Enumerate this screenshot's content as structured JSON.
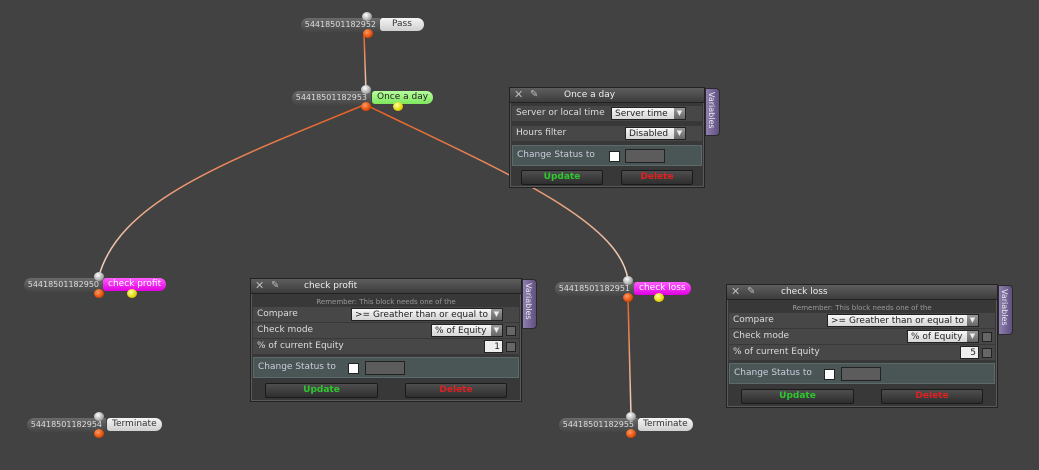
{
  "colors": {
    "wire_orange": "#e85e20",
    "wire_white": "#f0d8c8",
    "background": "#424242"
  },
  "nodes": {
    "pass": {
      "id": "54418501182952",
      "label": "Pass"
    },
    "once": {
      "id": "54418501182953",
      "label": "Once a day"
    },
    "profit": {
      "id": "54418501182950",
      "label": "check profit"
    },
    "loss": {
      "id": "54418501182951",
      "label": "check loss"
    },
    "term_profit": {
      "id": "54418501182954",
      "label": "Terminate"
    },
    "term_loss": {
      "id": "54418501182955",
      "label": "Terminate"
    }
  },
  "panel_once": {
    "title": "Once a day",
    "tab": "Variables",
    "server_label": "Server or local time",
    "server_value": "Server time",
    "hours_label": "Hours filter",
    "hours_value": "Disabled",
    "status_label": "Change Status to",
    "update": "Update",
    "delete": "Delete"
  },
  "panel_profit": {
    "title": "check profit",
    "tab": "Variables",
    "note": "Remember: This block needs one of the",
    "compare_label": "Compare",
    "compare_value": ">= Greather than or equal to",
    "mode_label": "Check mode",
    "mode_value": "% of Equity",
    "equity_label": "% of current Equity",
    "equity_value": "1",
    "status_label": "Change Status to",
    "update": "Update",
    "delete": "Delete"
  },
  "panel_loss": {
    "title": "check loss",
    "tab": "Variables",
    "note": "Remember: This block needs one of the",
    "compare_label": "Compare",
    "compare_value": ">= Greather than or equal to",
    "mode_label": "Check mode",
    "mode_value": "% of Equity",
    "equity_label": "% of current Equity",
    "equity_value": "5",
    "status_label": "Change Status to",
    "update": "Update",
    "delete": "Delete"
  }
}
